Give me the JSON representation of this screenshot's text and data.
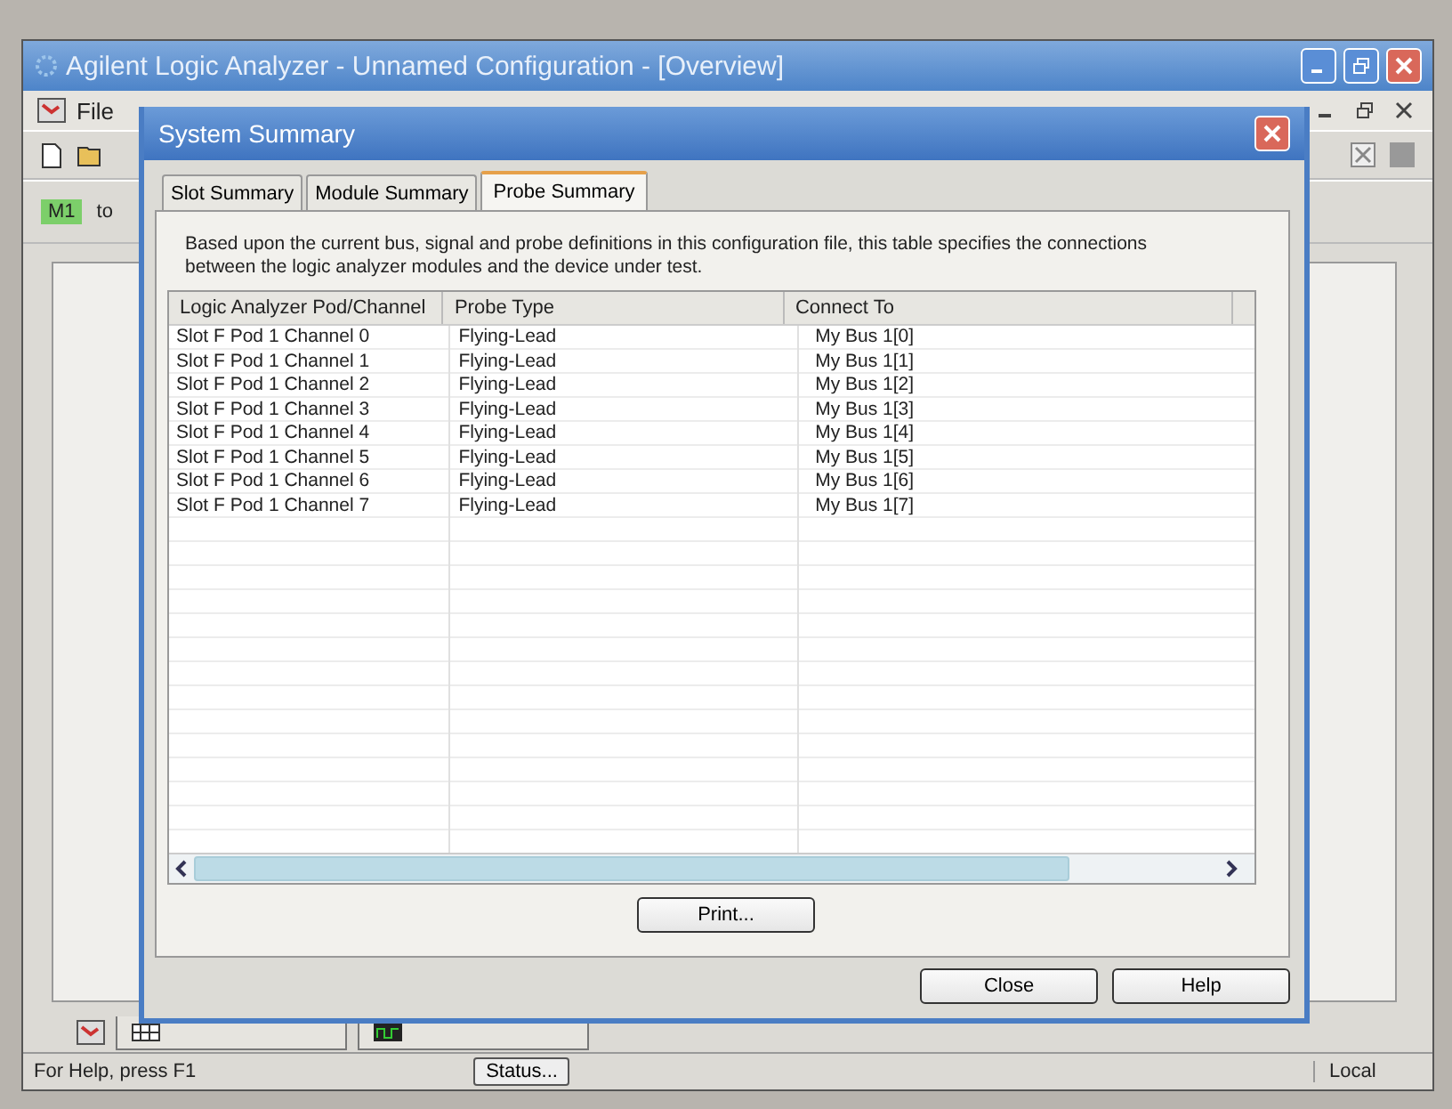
{
  "window": {
    "title": "Agilent Logic Analyzer - Unnamed Configuration - [Overview]"
  },
  "menu": [
    "File"
  ],
  "toolbar2": {
    "badge": "M1",
    "text": "to"
  },
  "dialog": {
    "title": "System Summary",
    "tabs": [
      {
        "label": "Slot Summary",
        "selected": false
      },
      {
        "label": "Module Summary",
        "selected": false
      },
      {
        "label": "Probe Summary",
        "selected": true
      }
    ],
    "description": "Based upon the current bus, signal and probe definitions in this configuration file, this table specifies the connections between the logic analyzer modules and the device under test.",
    "table": {
      "columns": [
        "Logic Analyzer Pod/Channel",
        "Probe Type",
        "Connect To"
      ],
      "rows": [
        [
          "Slot F Pod 1 Channel 0",
          "Flying-Lead",
          "My Bus 1[0]"
        ],
        [
          "Slot F Pod 1 Channel 1",
          "Flying-Lead",
          "My Bus 1[1]"
        ],
        [
          "Slot F Pod 1 Channel 2",
          "Flying-Lead",
          "My Bus 1[2]"
        ],
        [
          "Slot F Pod 1 Channel 3",
          "Flying-Lead",
          "My Bus 1[3]"
        ],
        [
          "Slot F Pod 1 Channel 4",
          "Flying-Lead",
          "My Bus 1[4]"
        ],
        [
          "Slot F Pod 1 Channel 5",
          "Flying-Lead",
          "My Bus 1[5]"
        ],
        [
          "Slot F Pod 1 Channel 6",
          "Flying-Lead",
          "My Bus 1[6]"
        ],
        [
          "Slot F Pod 1 Channel 7",
          "Flying-Lead",
          "My Bus 1[7]"
        ]
      ]
    },
    "print_button": "Print...",
    "buttons": [
      "Close",
      "Help"
    ]
  },
  "status_bar": {
    "help": "For Help, press F1",
    "status_button": "Status...",
    "mode": "Local"
  }
}
